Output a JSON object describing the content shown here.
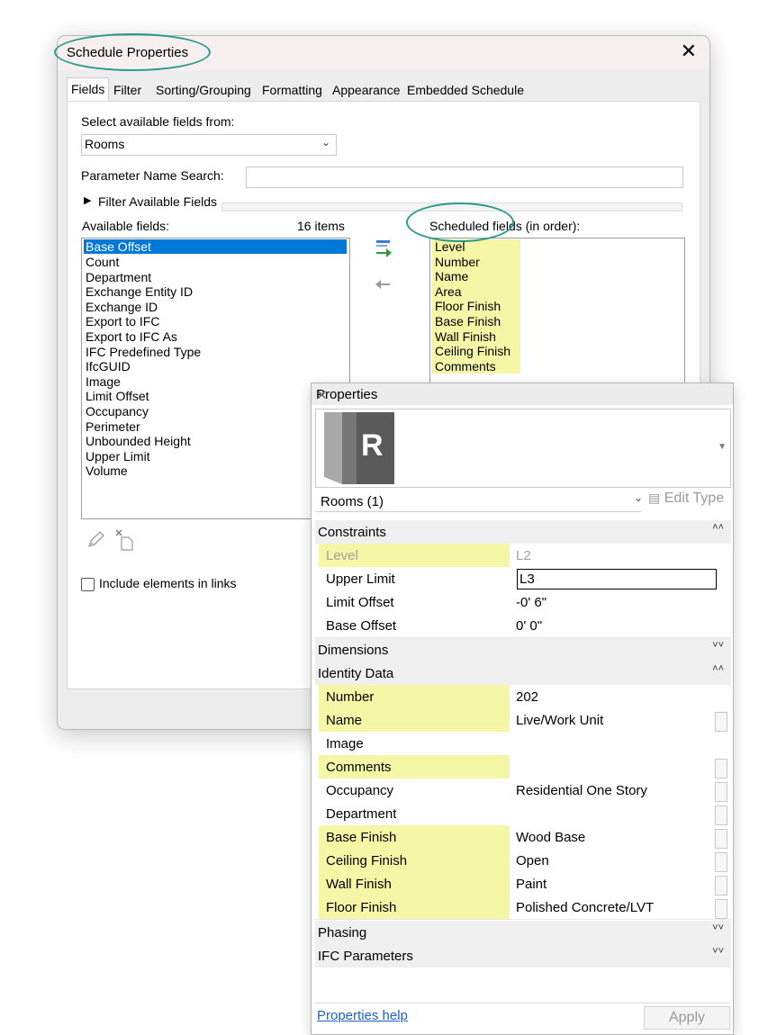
{
  "dialog": {
    "title": "Schedule Properties",
    "close": "✕",
    "tabs": [
      "Fields",
      "Filter",
      "Sorting/Grouping",
      "Formatting",
      "Appearance",
      "Embedded Schedule"
    ],
    "select_label": "Select available fields from:",
    "category": "Rooms",
    "param_search_label": "Parameter Name Search:",
    "param_search_value": "",
    "filter_toggle": "▶",
    "filter_label": "Filter Available Fields",
    "available_label": "Available fields:",
    "available_count": "16 items",
    "available_fields": [
      "Base Offset",
      "Count",
      "Department",
      "Exchange Entity ID",
      "Exchange ID",
      "Export to IFC",
      "Export to IFC As",
      "IFC Predefined Type",
      "IfcGUID",
      "Image",
      "Limit Offset",
      "Occupancy",
      "Perimeter",
      "Unbounded Height",
      "Upper Limit",
      "Volume"
    ],
    "scheduled_label": "Scheduled fields (in order):",
    "scheduled_fields": [
      "Level",
      "Number",
      "Name",
      "Area",
      "Floor Finish",
      "Base Finish",
      "Wall Finish",
      "Ceiling Finish",
      "Comments"
    ],
    "include_links_label": "Include elements in links"
  },
  "properties": {
    "title": "Properties",
    "close": "✕",
    "logo_letter": "R",
    "type_selector": "Rooms (1)",
    "edit_type": "Edit Type",
    "groups": {
      "constraints": "Constraints",
      "dimensions": "Dimensions",
      "identity": "Identity Data",
      "phasing": "Phasing",
      "ifc": "IFC Parameters"
    },
    "constraints": [
      {
        "name": "Level",
        "value": "L2"
      },
      {
        "name": "Upper Limit",
        "value": "L3"
      },
      {
        "name": "Limit Offset",
        "value": "-0'  6\""
      },
      {
        "name": "Base Offset",
        "value": "0'  0\""
      }
    ],
    "identity": [
      {
        "name": "Number",
        "value": "202"
      },
      {
        "name": "Name",
        "value": "Live/Work Unit"
      },
      {
        "name": "Image",
        "value": ""
      },
      {
        "name": "Comments",
        "value": ""
      },
      {
        "name": "Occupancy",
        "value": "Residential One Story"
      },
      {
        "name": "Department",
        "value": ""
      },
      {
        "name": "Base Finish",
        "value": "Wood Base"
      },
      {
        "name": "Ceiling Finish",
        "value": "Open"
      },
      {
        "name": "Wall Finish",
        "value": "Paint"
      },
      {
        "name": "Floor Finish",
        "value": "Polished Concrete/LVT"
      }
    ],
    "help": "Properties help",
    "apply": "Apply"
  },
  "colors": {
    "highlight": "#f6f7a6",
    "annotation_ring": "#2b9a8a",
    "selection": "#0078d7",
    "link": "#1a62c4"
  }
}
